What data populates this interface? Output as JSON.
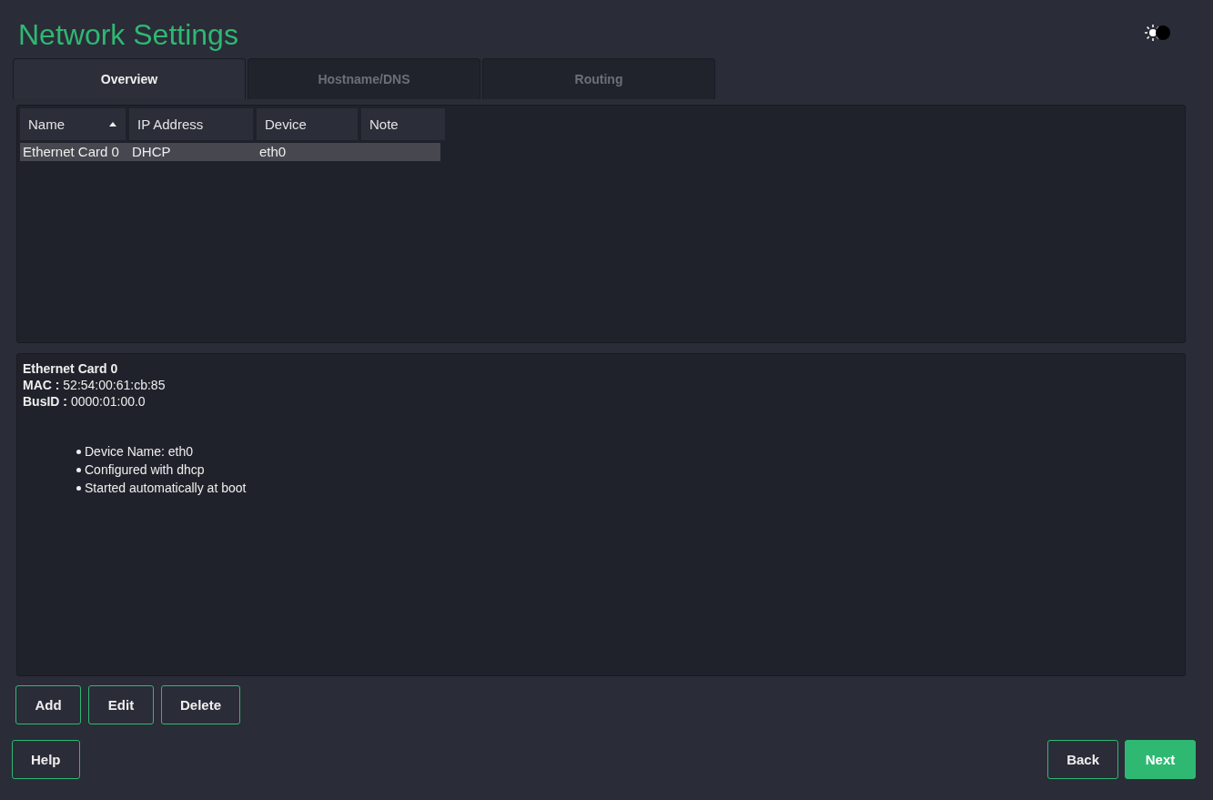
{
  "window": {
    "title": "Network Settings"
  },
  "theme_toggle": {
    "on": false
  },
  "tabs": [
    {
      "label": "Overview",
      "selected": true
    },
    {
      "label": "Hostname/DNS",
      "selected": false
    },
    {
      "label": "Routing",
      "selected": false
    }
  ],
  "table": {
    "columns": [
      {
        "label": "Name",
        "sorted": true
      },
      {
        "label": "IP Address",
        "sorted": false
      },
      {
        "label": "Device",
        "sorted": false
      },
      {
        "label": "Note",
        "sorted": false
      }
    ],
    "rows": [
      {
        "cells": [
          "Ethernet Card 0",
          "DHCP",
          "eth0",
          ""
        ],
        "selected": true
      }
    ]
  },
  "details": {
    "title": "Ethernet Card 0",
    "fields": [
      {
        "label": "MAC :",
        "value": "52:54:00:61:cb:85"
      },
      {
        "label": "BusID :",
        "value": "0000:01:00.0"
      }
    ],
    "bullets": [
      "Device Name: eth0",
      "Configured with dhcp",
      "Started automatically at boot"
    ]
  },
  "table_buttons": [
    {
      "label": "Add",
      "kind": "outline"
    },
    {
      "label": "Edit",
      "kind": "outline"
    },
    {
      "label": "Delete",
      "kind": "outline"
    }
  ],
  "footer_left": [
    {
      "label": "Help",
      "kind": "outline"
    }
  ],
  "footer_right": [
    {
      "label": "Back",
      "kind": "outline"
    },
    {
      "label": "Next",
      "kind": "primary"
    }
  ]
}
